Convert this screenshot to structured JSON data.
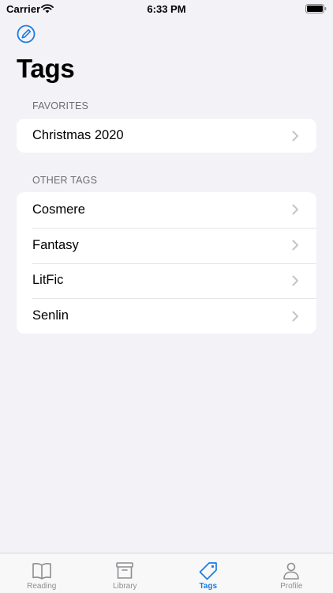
{
  "status_bar": {
    "carrier": "Carrier",
    "time": "6:33 PM"
  },
  "header": {
    "edit_icon": "edit-circle-icon",
    "title": "Tags"
  },
  "sections": {
    "favorites": {
      "header": "FAVORITES",
      "items": [
        "Christmas 2020"
      ]
    },
    "other": {
      "header": "OTHER TAGS",
      "items": [
        "Cosmere",
        "Fantasy",
        "LitFic",
        "Senlin"
      ]
    }
  },
  "tab_bar": {
    "tabs": [
      {
        "label": "Reading",
        "icon": "book-icon",
        "active": false
      },
      {
        "label": "Library",
        "icon": "archive-box-icon",
        "active": false
      },
      {
        "label": "Tags",
        "icon": "tag-icon",
        "active": true
      },
      {
        "label": "Profile",
        "icon": "person-icon",
        "active": false
      }
    ]
  },
  "colors": {
    "accent": "#1c7ce0",
    "background": "#f2f2f7",
    "inactive": "#8e8e93"
  }
}
